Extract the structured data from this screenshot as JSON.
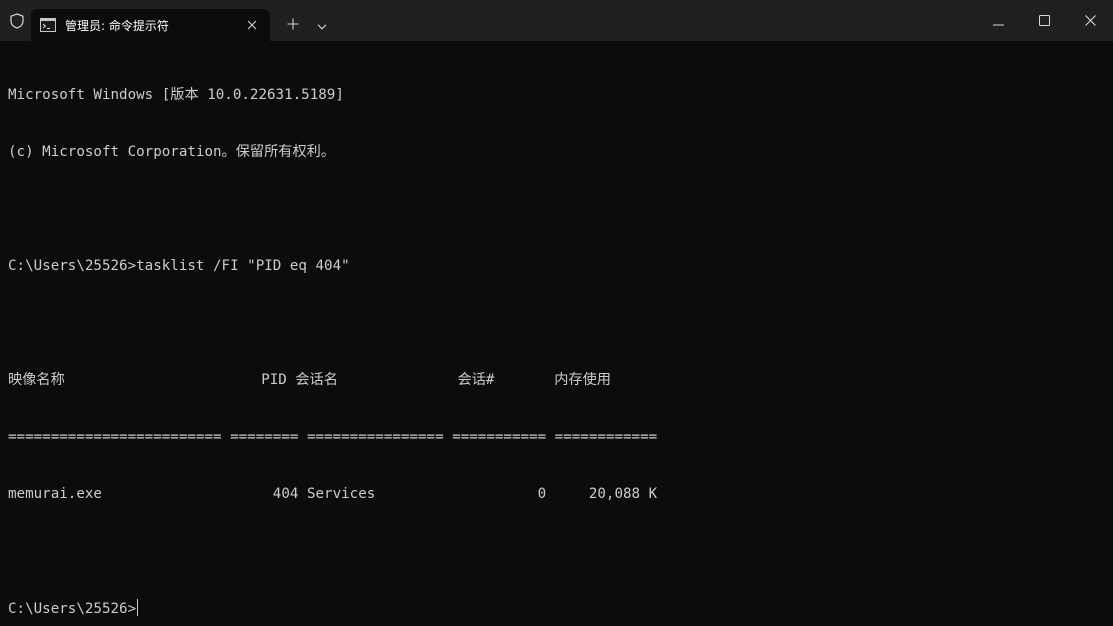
{
  "window": {
    "tab_title": "管理员: 命令提示符",
    "icons": {
      "shield": "shield-icon",
      "tab": "command-prompt-icon",
      "tab_close": "close-icon",
      "new_tab": "plus-icon",
      "dropdown": "chevron-down-icon",
      "minimize": "minimize-icon",
      "maximize": "maximize-icon",
      "close": "close-icon"
    },
    "colors": {
      "titlebar": "#202020",
      "terminal_bg": "#0c0c0c",
      "text": "#cccccc"
    }
  },
  "terminal": {
    "lines": [
      "Microsoft Windows [版本 10.0.22631.5189]",
      "(c) Microsoft Corporation。保留所有权利。",
      "",
      "C:\\Users\\25526>tasklist /FI \"PID eq 404\"",
      "",
      "映像名称                       PID 会话名              会话#       内存使用",
      "========================= ======== ================ =========== ============",
      "memurai.exe                    404 Services                   0     20,088 K",
      ""
    ],
    "prompt": "C:\\Users\\25526>"
  }
}
